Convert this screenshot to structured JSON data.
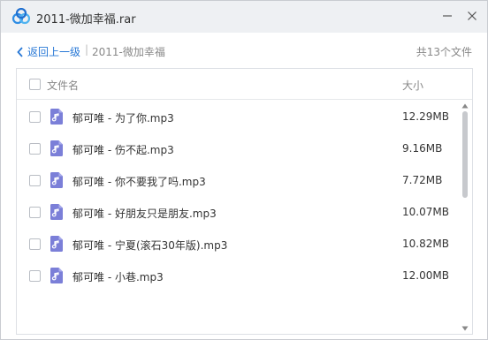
{
  "window": {
    "title": "2011-微加幸福.rar",
    "accent": "#2878d6"
  },
  "nav": {
    "back_label": "返回上一级",
    "separator": "|",
    "breadcrumb": "2011-微加幸福",
    "file_count": "共13个文件"
  },
  "list": {
    "col_name": "文件名",
    "col_size": "大小",
    "files": [
      {
        "name": "郁可唯 - 为了你.mp3",
        "size": "12.29MB"
      },
      {
        "name": "郁可唯 - 伤不起.mp3",
        "size": "9.16MB"
      },
      {
        "name": "郁可唯 - 你不要我了吗.mp3",
        "size": "7.72MB"
      },
      {
        "name": "郁可唯 - 好朋友只是朋友.mp3",
        "size": "10.07MB"
      },
      {
        "name": "郁可唯 - 宁夏(滚石30年版).mp3",
        "size": "10.82MB"
      },
      {
        "name": "郁可唯 - 小巷.mp3",
        "size": "12.00MB"
      }
    ],
    "file_icon": "music-file-icon",
    "icon_color": "#7b7fd8"
  }
}
